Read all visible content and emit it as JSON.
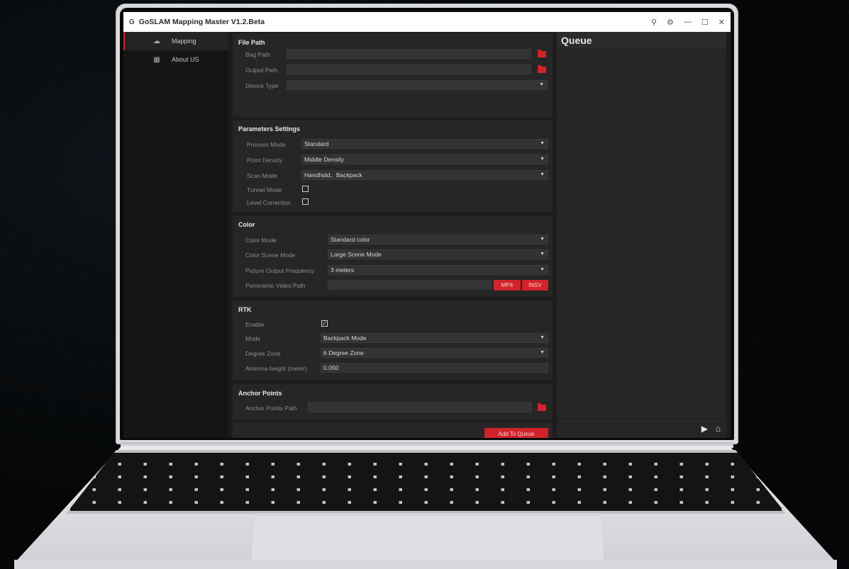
{
  "window": {
    "logo": "G",
    "title": "GoSLAM Mapping Master V1.2.Beta",
    "controls": {
      "pin": "⚲",
      "settings": "⚙",
      "minimize": "—",
      "maximize": "☐",
      "close": "✕"
    }
  },
  "sidebar": {
    "items": [
      {
        "label": "Mapping",
        "icon": "cloud-icon",
        "active": true
      },
      {
        "label": "About US",
        "icon": "grid-icon",
        "active": false
      }
    ]
  },
  "file_path": {
    "title": "File Path",
    "bag_path_label": "Bag Path",
    "bag_path_value": "",
    "output_path_label": "Output Path",
    "output_path_value": "",
    "device_type_label": "Device Type",
    "device_type_value": ""
  },
  "parameters": {
    "title": "Parameters Settings",
    "process_mode_label": "Process Mode",
    "process_mode_value": "Standard",
    "point_density_label": "Point Density",
    "point_density_value": "Middle Density",
    "scan_mode_label": "Scan Mode",
    "scan_mode_value": "Handhold、Backpack",
    "tunnel_mode_label": "Tunnel Mode",
    "tunnel_mode_checked": false,
    "level_correction_label": "Level Correction",
    "level_correction_checked": false
  },
  "color": {
    "title": "Color",
    "color_mode_label": "Color Mode",
    "color_mode_value": "Standard color",
    "color_scene_label": "Color Scene Mode",
    "color_scene_value": "Large Scene Mode",
    "picture_freq_label": "Picture Output Frequency",
    "picture_freq_value": "3 meters",
    "pano_video_label": "Panoramic Video Path",
    "pano_video_value": "",
    "mp4_button": "MP4",
    "insv_button": "INSV"
  },
  "rtk": {
    "title": "RTK",
    "enable_label": "Enable",
    "enable_checked": true,
    "mode_label": "Mode",
    "mode_value": "Backpack Mode",
    "degree_zone_label": "Degree Zone",
    "degree_zone_value": "6 Degree Zone",
    "antenna_label": "Antenna height (meter)",
    "antenna_value": "0.050"
  },
  "anchor": {
    "title": "Anchor Points",
    "path_label": "Anchor Points Path",
    "path_value": ""
  },
  "actions": {
    "add_to_queue": "Add To Queue"
  },
  "queue": {
    "title": "Queue",
    "play": "▶",
    "clear": "⌂"
  },
  "colors": {
    "accent": "#d2232a",
    "panel": "#262626",
    "background": "#1c1c1c"
  }
}
